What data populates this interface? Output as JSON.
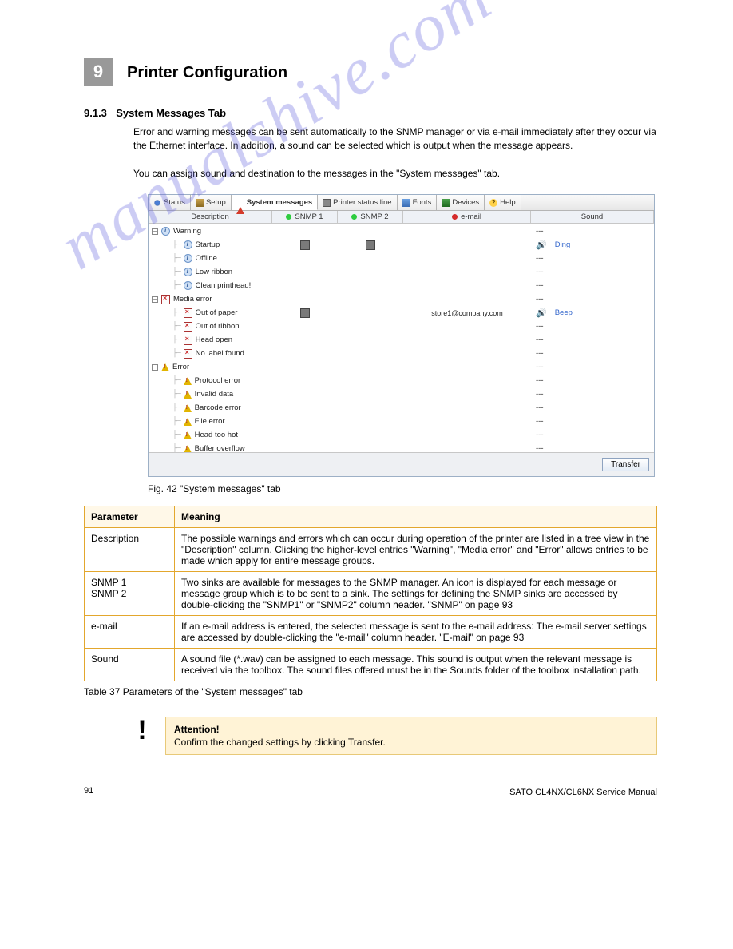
{
  "chapter": {
    "number": "9",
    "title": "Printer Configuration"
  },
  "section": {
    "number": "9.1.3",
    "title": "System Messages Tab"
  },
  "intro": {
    "p1": "Error and warning messages can be sent automatically to the SNMP manager or via e-mail immediately after they occur via the Ethernet interface. In addition, a sound can be selected which is output when the message appears.",
    "p2": "You can assign sound and destination to the messages in the \"System messages\" tab."
  },
  "tabs": [
    {
      "id": "status",
      "label": "Status"
    },
    {
      "id": "setup",
      "label": "Setup"
    },
    {
      "id": "sysmsg",
      "label": " System messages",
      "active": true
    },
    {
      "id": "pstatus",
      "label": "Printer status line"
    },
    {
      "id": "fonts",
      "label": "Fonts"
    },
    {
      "id": "devices",
      "label": "Devices"
    },
    {
      "id": "help",
      "label": "Help"
    }
  ],
  "columns": {
    "description": "Description",
    "snmp1": "SNMP 1",
    "snmp2": "SNMP 2",
    "email": "e-mail",
    "sound": "Sound"
  },
  "tree": [
    {
      "type": "group",
      "level": 0,
      "icon": "info",
      "label": "Warning",
      "sound": "---"
    },
    {
      "type": "item",
      "level": 1,
      "icon": "info",
      "label": "Startup",
      "snmp1": true,
      "snmp2": true,
      "sound": "Ding",
      "speaker": true
    },
    {
      "type": "item",
      "level": 1,
      "icon": "info",
      "label": "Offline",
      "sound": "---"
    },
    {
      "type": "item",
      "level": 1,
      "icon": "info",
      "label": "Low ribbon",
      "sound": "---"
    },
    {
      "type": "item",
      "level": 1,
      "icon": "info",
      "label": "Clean printhead!",
      "sound": "---"
    },
    {
      "type": "group",
      "level": 0,
      "icon": "docx",
      "label": "Media error",
      "sound": "---"
    },
    {
      "type": "item",
      "level": 1,
      "icon": "docx",
      "label": "Out of paper",
      "snmp1": true,
      "email": "store1@company.com",
      "sound": "Beep",
      "speaker": true
    },
    {
      "type": "item",
      "level": 1,
      "icon": "docx",
      "label": "Out of ribbon",
      "sound": "---"
    },
    {
      "type": "item",
      "level": 1,
      "icon": "docx",
      "label": "Head open",
      "sound": "---"
    },
    {
      "type": "item",
      "level": 1,
      "icon": "docx",
      "label": "No label found",
      "sound": "---"
    },
    {
      "type": "group",
      "level": 0,
      "icon": "err",
      "label": "Error",
      "sound": "---"
    },
    {
      "type": "item",
      "level": 1,
      "icon": "err",
      "label": "Protocol error",
      "sound": "---"
    },
    {
      "type": "item",
      "level": 1,
      "icon": "err",
      "label": "Invalid data",
      "sound": "---"
    },
    {
      "type": "item",
      "level": 1,
      "icon": "err",
      "label": "Barcode error",
      "sound": "---"
    },
    {
      "type": "item",
      "level": 1,
      "icon": "err",
      "label": "File error",
      "sound": "---"
    },
    {
      "type": "item",
      "level": 1,
      "icon": "err",
      "label": "Head too hot",
      "sound": "---"
    },
    {
      "type": "item",
      "level": 1,
      "icon": "err",
      "label": "Buffer overflow",
      "sound": "---"
    }
  ],
  "transfer_btn": "Transfer",
  "figure_caption": "Fig. 42 \"System messages\" tab",
  "ptable": {
    "head": {
      "c1": "Parameter",
      "c2": "Meaning"
    },
    "rows": [
      {
        "c1": "Description",
        "c2": "The possible warnings and errors which can occur during operation of the printer are listed in a tree view in the \"Description\" column. Clicking the higher-level entries \"Warning\", \"Media error\" and \"Error\" allows entries to be made which apply for entire message groups."
      },
      {
        "c1": "SNMP 1\nSNMP 2",
        "c2": "Two sinks are available for messages to the SNMP manager. An icon is displayed for each message or message group which is to be sent to a sink. The settings for defining the SNMP sinks are accessed by double-clicking the \"SNMP1\" or \"SNMP2\" column header.  \"SNMP\" on page 93"
      },
      {
        "c1": "e-mail",
        "c2": "If an e-mail address is entered, the selected message is sent to the e-mail address: The e-mail server settings are accessed by double-clicking the \"e-mail\" column header.  \"E-mail\" on page 93"
      },
      {
        "c1": "Sound",
        "c2": "A sound file (*.wav) can be assigned to each message. This sound is output when the relevant message is received via the toolbox. The sound files offered must be in the Sounds folder of the toolbox installation path."
      }
    ]
  },
  "table_caption": "Table 37 Parameters of the \"System messages\" tab",
  "attention": {
    "title": "Attention!",
    "body": "Confirm the changed settings by clicking Transfer."
  },
  "page_number": "91",
  "page_brand": "SATO CL4NX/CL6NX Service Manual",
  "watermark": "manualshive.com"
}
